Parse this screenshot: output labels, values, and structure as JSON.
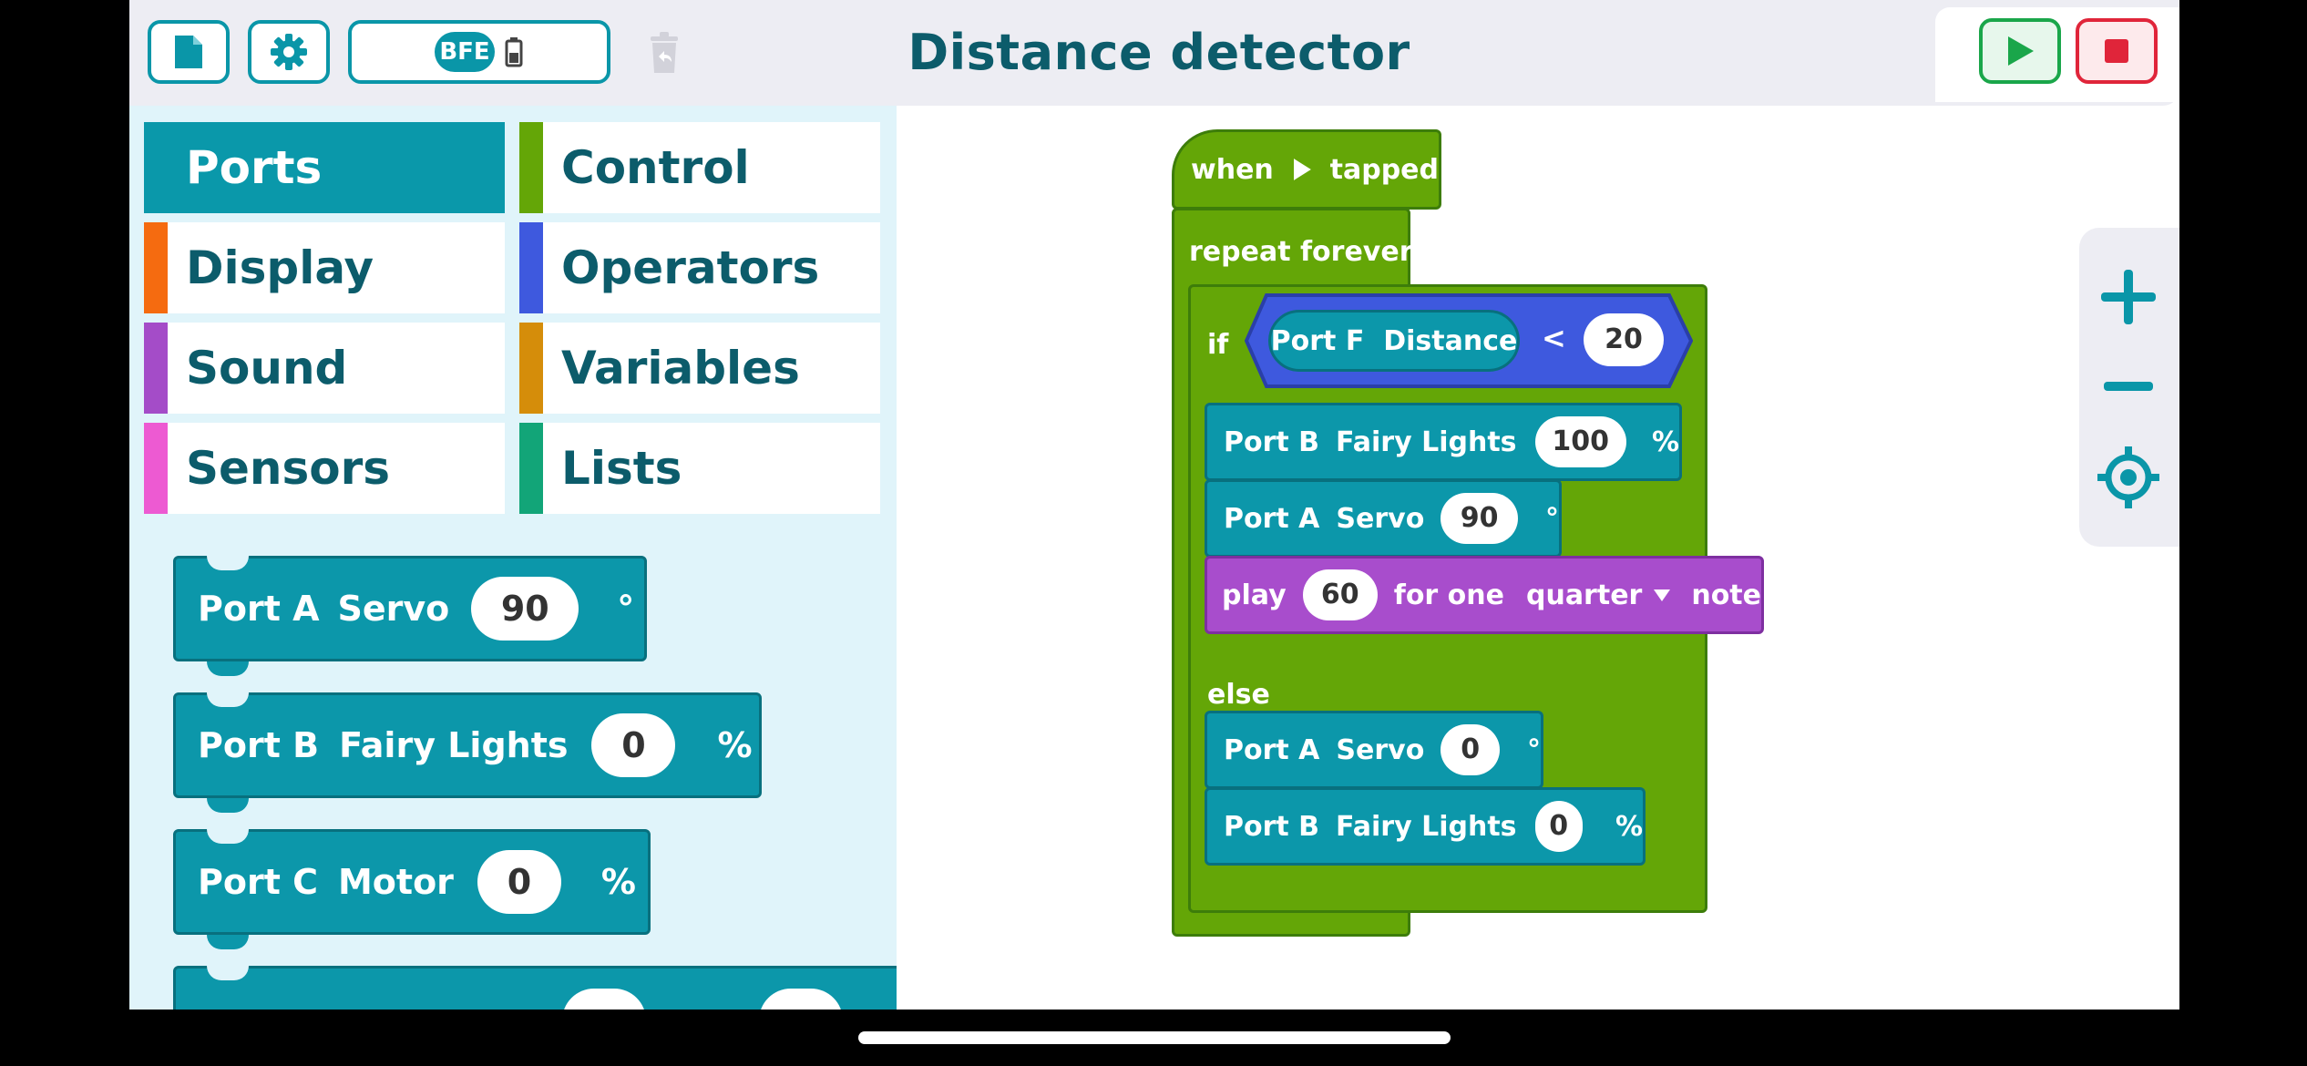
{
  "app": {
    "title": "Distance detector"
  },
  "toolbar": {
    "hub_name": "BFE"
  },
  "categories": [
    {
      "label": "Ports",
      "color": "#0a98aa",
      "active": true
    },
    {
      "label": "Control",
      "color": "#64a607"
    },
    {
      "label": "Display",
      "color": "#f56b10"
    },
    {
      "label": "Operators",
      "color": "#3e59de"
    },
    {
      "label": "Sound",
      "color": "#a44cc8"
    },
    {
      "label": "Variables",
      "color": "#d58d0a"
    },
    {
      "label": "Sensors",
      "color": "#ed5ad2"
    },
    {
      "label": "Lists",
      "color": "#12a578"
    }
  ],
  "palette_blocks": {
    "servo": {
      "port": "Port A",
      "device": "Servo",
      "value": "90",
      "unit": "°"
    },
    "lights": {
      "port": "Port B",
      "device": "Fairy Lights",
      "value": "0",
      "unit": "%"
    },
    "motor": {
      "port": "Port C",
      "device": "Motor",
      "value": "0",
      "unit": "%"
    }
  },
  "script": {
    "hat": {
      "when": "when",
      "tapped": "tapped"
    },
    "repeat": "repeat forever",
    "if_label": "if",
    "condition": {
      "sensor": "Port F  Distance",
      "op": "<",
      "value": "20"
    },
    "then_lights": {
      "port": "Port B",
      "device": "Fairy Lights",
      "value": "100",
      "unit": "%"
    },
    "then_servo": {
      "port": "Port A",
      "device": "Servo",
      "value": "90",
      "unit": "°"
    },
    "play": {
      "play": "play",
      "note": "60",
      "for_one": "for one",
      "duration": "quarter",
      "note_label": "note"
    },
    "else_label": "else",
    "else_servo": {
      "port": "Port A",
      "device": "Servo",
      "value": "0",
      "unit": "°"
    },
    "else_lights": {
      "port": "Port B",
      "device": "Fairy Lights",
      "value": "0",
      "unit": "%"
    }
  },
  "colors": {
    "ports": "#0c97aa",
    "control": "#64a607",
    "operators": "#3e59de",
    "sound": "#a84dcc",
    "run": "#1aa64a",
    "stop": "#e0253a"
  }
}
